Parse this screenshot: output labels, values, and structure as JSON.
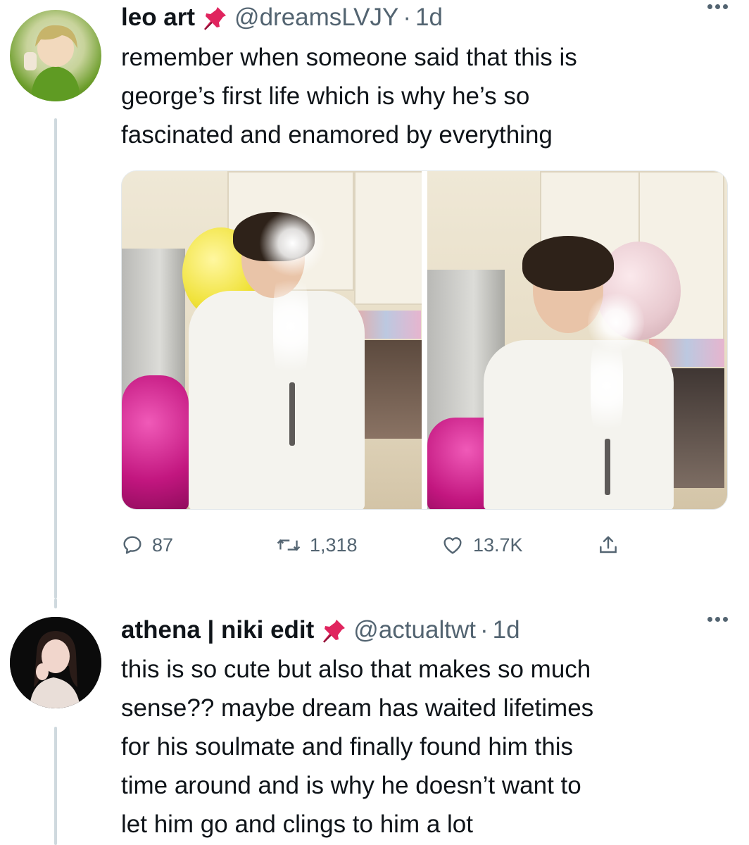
{
  "tweets": [
    {
      "display_name": "leo art",
      "badge_icon": "pushpin-icon",
      "handle": "@dreamsLVJY",
      "separator": "·",
      "time": "1d",
      "text": "remember when someone said that this is\ngeorge’s first life which is why he’s so\nfascinated and enamored by everything",
      "stats": {
        "replies": "87",
        "retweets": "1,318",
        "likes": "13.7K"
      }
    },
    {
      "display_name": "athena | niki edit",
      "badge_icon": "pushpin-icon",
      "handle": "@actualtwt",
      "separator": "·",
      "time": "1d",
      "text": "this is so cute but also that makes so much\nsense?? maybe dream has waited lifetimes\nfor his soulmate and finally found him this\ntime around and is why he doesn’t want to\nlet him go and clings to him a lot"
    }
  ],
  "icons": {
    "reply": "reply-icon",
    "retweet": "retweet-icon",
    "like": "heart-icon",
    "share": "share-icon",
    "more": "more-icon"
  },
  "colors": {
    "text": "#0f1419",
    "secondary": "#536471",
    "thread_line": "#cfd9de",
    "pin": "#e0245e"
  }
}
